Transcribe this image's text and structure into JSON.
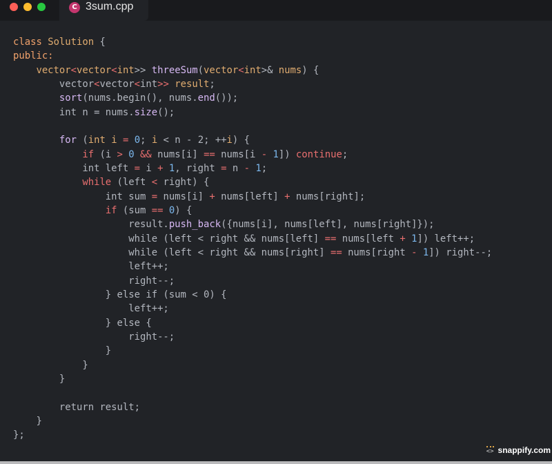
{
  "window": {
    "tab_title": "3sum.cpp",
    "tab_icon_glyph": "C",
    "tab_icon_name": "cpp-file-icon",
    "traffic_lights": [
      {
        "name": "close-window-button",
        "color": "#fe5f57"
      },
      {
        "name": "minimize-window-button",
        "color": "#febc2e"
      },
      {
        "name": "zoom-window-button",
        "color": "#28c840"
      }
    ]
  },
  "code": {
    "language": "cpp",
    "lines": [
      [
        [
          "class",
          "kw2"
        ],
        [
          " ",
          "plain"
        ],
        [
          "Solution",
          "type"
        ],
        [
          " {",
          "plain"
        ]
      ],
      [
        [
          "public:",
          "kw2"
        ]
      ],
      [
        [
          "    vector",
          "type"
        ],
        [
          "<",
          "op"
        ],
        [
          "vector",
          "type"
        ],
        [
          "<",
          "op"
        ],
        [
          "int",
          "type"
        ],
        [
          ">> ",
          "plain"
        ],
        [
          "threeSum",
          "fn"
        ],
        [
          "(",
          "plain"
        ],
        [
          "vector",
          "type"
        ],
        [
          "<",
          "op"
        ],
        [
          "int",
          "type"
        ],
        [
          ">& ",
          "plain"
        ],
        [
          "nums",
          "type"
        ],
        [
          ") {",
          "plain"
        ]
      ],
      [
        [
          "        vector",
          "plain"
        ],
        [
          "<",
          "op"
        ],
        [
          "vector",
          "plain"
        ],
        [
          "<",
          "op"
        ],
        [
          "int",
          "plain"
        ],
        [
          ">>",
          "op"
        ],
        [
          " ",
          "plain"
        ],
        [
          "result",
          "type"
        ],
        [
          ";",
          "plain"
        ]
      ],
      [
        [
          "        ",
          "plain"
        ],
        [
          "sort",
          "fn"
        ],
        [
          "(nums.begin(), nums.",
          "plain"
        ],
        [
          "end",
          "fn"
        ],
        [
          "());",
          "plain"
        ]
      ],
      [
        [
          "        int n = nums.",
          "plain"
        ],
        [
          "size",
          "fn"
        ],
        [
          "();",
          "plain"
        ]
      ],
      [
        [
          "",
          "plain"
        ]
      ],
      [
        [
          "        ",
          "plain"
        ],
        [
          "for",
          "fn"
        ],
        [
          " (",
          "plain"
        ],
        [
          "int",
          "type"
        ],
        [
          " ",
          "plain"
        ],
        [
          "i",
          "type"
        ],
        [
          " ",
          "plain"
        ],
        [
          "=",
          "op"
        ],
        [
          " ",
          "plain"
        ],
        [
          "0",
          "num"
        ],
        [
          "; ",
          "plain"
        ],
        [
          "i",
          "type"
        ],
        [
          " < n - 2; ++",
          "plain"
        ],
        [
          "i",
          "type"
        ],
        [
          ") {",
          "plain"
        ]
      ],
      [
        [
          "            ",
          "plain"
        ],
        [
          "if",
          "kw"
        ],
        [
          " (i ",
          "plain"
        ],
        [
          ">",
          "op"
        ],
        [
          " ",
          "plain"
        ],
        [
          "0",
          "num"
        ],
        [
          " ",
          "plain"
        ],
        [
          "&&",
          "op"
        ],
        [
          " nums[i] ",
          "plain"
        ],
        [
          "==",
          "op"
        ],
        [
          " nums[i ",
          "plain"
        ],
        [
          "-",
          "op"
        ],
        [
          " ",
          "plain"
        ],
        [
          "1",
          "num"
        ],
        [
          "]) ",
          "plain"
        ],
        [
          "continue",
          "kw"
        ],
        [
          ";",
          "plain"
        ]
      ],
      [
        [
          "            int left ",
          "plain"
        ],
        [
          "=",
          "op"
        ],
        [
          " i ",
          "plain"
        ],
        [
          "+",
          "op"
        ],
        [
          " ",
          "plain"
        ],
        [
          "1",
          "num"
        ],
        [
          ", right ",
          "plain"
        ],
        [
          "=",
          "op"
        ],
        [
          " n ",
          "plain"
        ],
        [
          "-",
          "op"
        ],
        [
          " ",
          "plain"
        ],
        [
          "1",
          "num"
        ],
        [
          ";",
          "plain"
        ]
      ],
      [
        [
          "            ",
          "plain"
        ],
        [
          "while",
          "kw"
        ],
        [
          " (left ",
          "plain"
        ],
        [
          "<",
          "op"
        ],
        [
          " right) {",
          "plain"
        ]
      ],
      [
        [
          "                int sum ",
          "plain"
        ],
        [
          "=",
          "op"
        ],
        [
          " nums[i] ",
          "plain"
        ],
        [
          "+",
          "op"
        ],
        [
          " nums[left] ",
          "plain"
        ],
        [
          "+",
          "op"
        ],
        [
          " nums[right];",
          "plain"
        ]
      ],
      [
        [
          "                ",
          "plain"
        ],
        [
          "if",
          "kw"
        ],
        [
          " (sum ",
          "plain"
        ],
        [
          "==",
          "op"
        ],
        [
          " ",
          "plain"
        ],
        [
          "0",
          "num"
        ],
        [
          ") {",
          "plain"
        ]
      ],
      [
        [
          "                    result.",
          "plain"
        ],
        [
          "push_back",
          "fn"
        ],
        [
          "({nums[i], nums[left], nums[right]});",
          "plain"
        ]
      ],
      [
        [
          "                    while (left < right && nums[left] ",
          "plain"
        ],
        [
          "==",
          "op"
        ],
        [
          " nums[left ",
          "plain"
        ],
        [
          "+",
          "op"
        ],
        [
          " ",
          "plain"
        ],
        [
          "1",
          "num"
        ],
        [
          "]) left++;",
          "plain"
        ]
      ],
      [
        [
          "                    while (left < right && nums[right] ",
          "plain"
        ],
        [
          "==",
          "op"
        ],
        [
          " nums[right ",
          "plain"
        ],
        [
          "-",
          "op"
        ],
        [
          " ",
          "plain"
        ],
        [
          "1",
          "num"
        ],
        [
          "]) right--;",
          "plain"
        ]
      ],
      [
        [
          "                    left++;",
          "plain"
        ]
      ],
      [
        [
          "                    right--;",
          "plain"
        ]
      ],
      [
        [
          "                } else if (sum < 0) {",
          "plain"
        ]
      ],
      [
        [
          "                    left++;",
          "plain"
        ]
      ],
      [
        [
          "                } else {",
          "plain"
        ]
      ],
      [
        [
          "                    right--;",
          "plain"
        ]
      ],
      [
        [
          "                }",
          "plain"
        ]
      ],
      [
        [
          "            }",
          "plain"
        ]
      ],
      [
        [
          "        }",
          "plain"
        ]
      ],
      [
        [
          "",
          "plain"
        ]
      ],
      [
        [
          "        return result;",
          "plain"
        ]
      ],
      [
        [
          "    }",
          "plain"
        ]
      ],
      [
        [
          "};",
          "plain"
        ]
      ]
    ]
  },
  "watermark": {
    "icon_glyph": "<>",
    "icon_name": "code-brackets-icon",
    "text": "snappify.com"
  }
}
